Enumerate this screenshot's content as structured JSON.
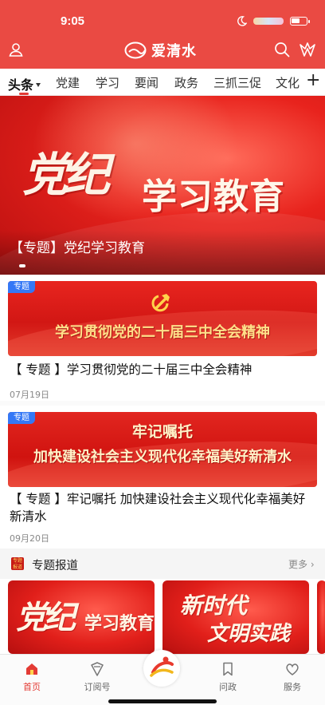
{
  "status_bar": {
    "time": "9:05"
  },
  "header": {
    "app_name": "爱清水",
    "user_icon": "user-icon",
    "search_icon": "search-icon",
    "brand_icon": "brand-logo-icon"
  },
  "tabs": {
    "items": [
      {
        "label": "头条",
        "active": true
      },
      {
        "label": "党建"
      },
      {
        "label": "学习"
      },
      {
        "label": "要闻"
      },
      {
        "label": "政务"
      },
      {
        "label": "三抓三促"
      },
      {
        "label": "文化"
      }
    ],
    "add_label": "+"
  },
  "hero": {
    "calligraphy": "党纪",
    "main_text": "学习教育",
    "caption": "【专题】党纪学习教育"
  },
  "articles": [
    {
      "badge": "专题",
      "image_text": "学习贯彻党的二十届三中全会精神",
      "title": "【 专题 】学习贯彻党的二十届三中全会精神",
      "date": "07月19日"
    },
    {
      "badge": "专题",
      "image_line1": "牢记嘱托",
      "image_line2": "加快建设社会主义现代化幸福美好新清水",
      "title": "【 专题 】牢记嘱托 加快建设社会主义现代化幸福美好新清水",
      "date": "09月20日"
    }
  ],
  "topic_section": {
    "title": "专题报道",
    "more_label": "更多",
    "icon_text": "专题报道",
    "cards": [
      {
        "calligraphy": "党纪",
        "text": "学习教育"
      },
      {
        "line1": "新时代",
        "line2": "文明实践"
      }
    ]
  },
  "bottom_nav": {
    "items": [
      {
        "label": "首页",
        "icon": "home-icon",
        "active": true
      },
      {
        "label": "订阅号",
        "icon": "subscribe-icon"
      },
      {
        "label": "问政",
        "icon": "bookmark-icon"
      },
      {
        "label": "服务",
        "icon": "heart-icon"
      }
    ],
    "center_icon": "center-logo-icon"
  },
  "colors": {
    "header_red": "#ea4a43",
    "accent_red": "#e33b34",
    "badge_blue": "#3478f6"
  }
}
